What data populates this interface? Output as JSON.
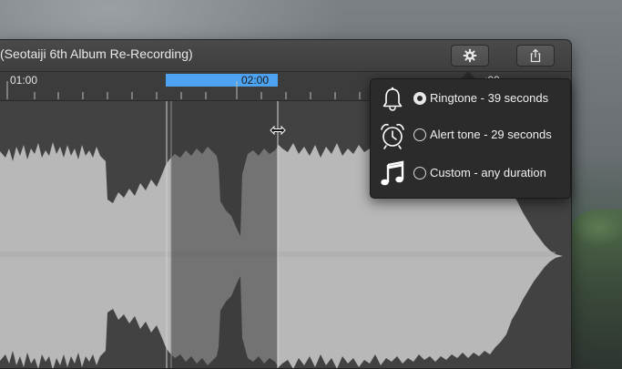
{
  "window": {
    "title": "(Seotaiji 6th Album Re-Recording)",
    "toolbar": {
      "settings_icon": "gear-icon",
      "share_icon": "share-icon"
    }
  },
  "timeline": {
    "label_start": "01:00",
    "label_selected": "02:00",
    "label_partial": ":00",
    "selection_color": "#4da3f0"
  },
  "waveform": {
    "selection_start_label": "",
    "cursor_icon": "resize-horizontal-cursor"
  },
  "popover": {
    "options": [
      {
        "icon": "bell-icon",
        "label": "Ringtone - 39 seconds",
        "selected": true
      },
      {
        "icon": "alarm-clock-icon",
        "label": "Alert tone - 29 seconds",
        "selected": false
      },
      {
        "icon": "music-note-icon",
        "label": "Custom - any duration",
        "selected": false
      }
    ]
  }
}
